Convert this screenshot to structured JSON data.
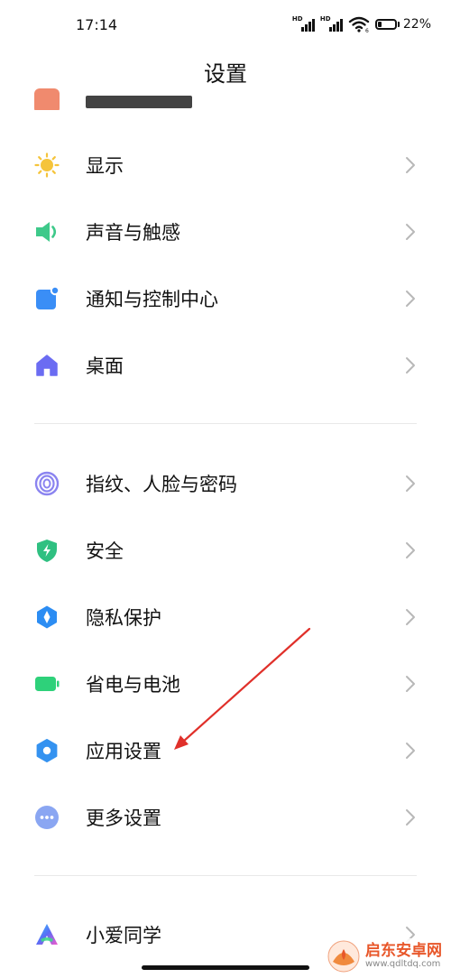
{
  "status_bar": {
    "time": "17:14",
    "battery_percent": "22%",
    "battery_level": 0.22,
    "signal_tags": [
      "HD",
      "HD"
    ],
    "wifi_badge": "6"
  },
  "header": {
    "title": "设置"
  },
  "groups": [
    {
      "items": [
        {
          "label": "显示",
          "icon": "brightness-icon",
          "color": "#f5c43b"
        },
        {
          "label": "声音与触感",
          "icon": "speaker-icon",
          "color": "#3ec98a"
        },
        {
          "label": "通知与控制中心",
          "icon": "notification-icon",
          "color": "#3a8ef6"
        },
        {
          "label": "桌面",
          "icon": "home-icon",
          "color": "#6b6cf2"
        }
      ]
    },
    {
      "items": [
        {
          "label": "指纹、人脸与密码",
          "icon": "fingerprint-icon",
          "color": "#8b84f0"
        },
        {
          "label": "安全",
          "icon": "shield-icon",
          "color": "#2fc081"
        },
        {
          "label": "隐私保护",
          "icon": "privacy-icon",
          "color": "#2c8df3"
        },
        {
          "label": "省电与电池",
          "icon": "battery-icon",
          "color": "#2ed17a"
        },
        {
          "label": "应用设置",
          "icon": "gear-icon",
          "color": "#3492f0"
        },
        {
          "label": "更多设置",
          "icon": "more-icon",
          "color": "#8aa6f2"
        }
      ]
    },
    {
      "items": [
        {
          "label": "小爱同学",
          "icon": "xiaoai-icon",
          "color": "#5a6cf5"
        }
      ]
    }
  ],
  "watermark": {
    "name": "启东安卓网",
    "url": "www.qdltdq.com"
  }
}
